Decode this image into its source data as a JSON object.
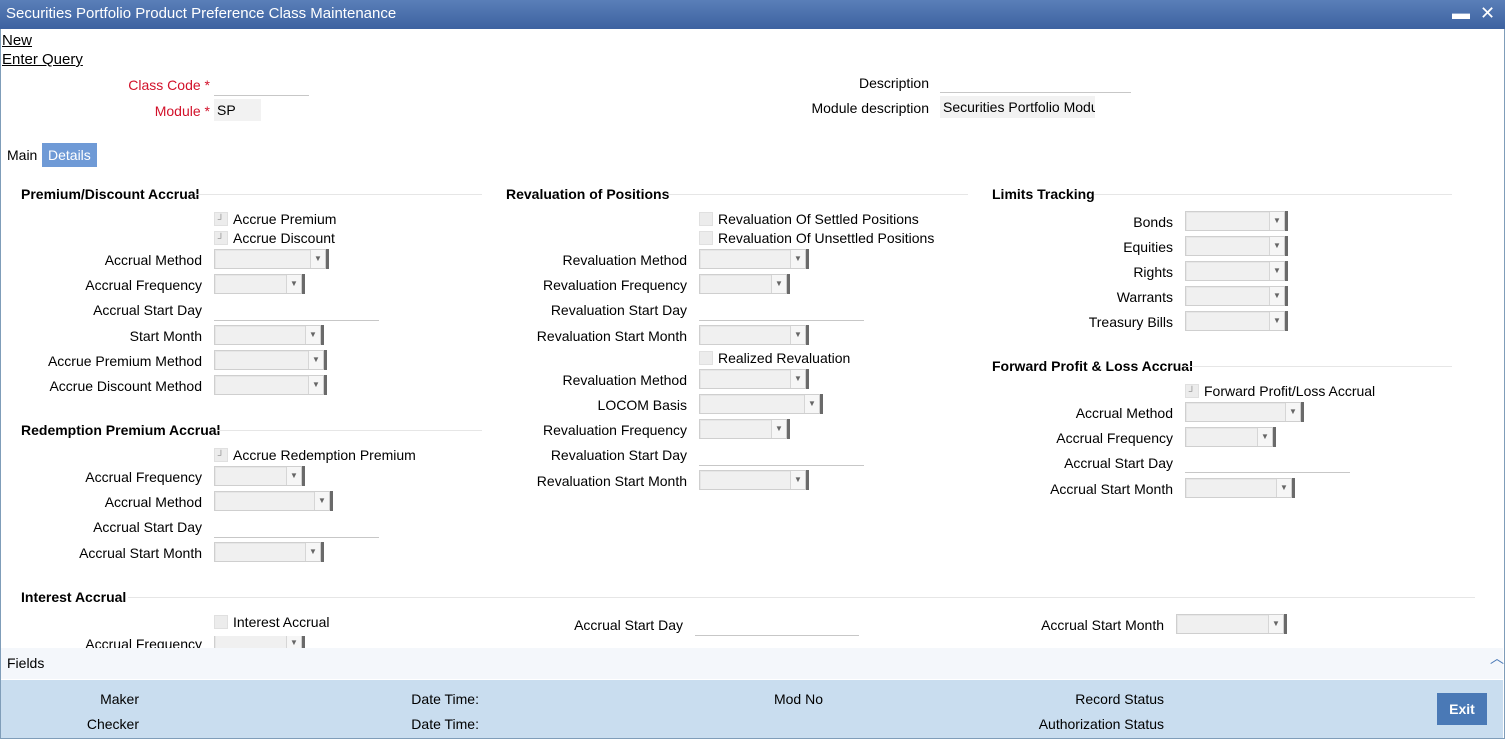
{
  "window": {
    "title": "Securities Portfolio Product Preference Class Maintenance",
    "minimize": "▬",
    "close": "✕"
  },
  "actions": {
    "new": "New",
    "enter_query": "Enter Query"
  },
  "header": {
    "class_code_label": "Class Code",
    "class_code_value": "",
    "module_label": "Module",
    "module_value": "SP",
    "required_mark": "*",
    "description_label": "Description",
    "description_value": "",
    "module_description_label": "Module description",
    "module_description_value": "Securities Portfolio Modul"
  },
  "tabs": [
    "Main",
    "Details"
  ],
  "active_tab": "Details",
  "premium_discount": {
    "title": "Premium/Discount Accrual",
    "accrue_premium": "Accrue Premium",
    "accrue_discount": "Accrue Discount",
    "accrual_method": "Accrual Method",
    "accrual_frequency": "Accrual Frequency",
    "accrual_start_day": "Accrual Start Day",
    "start_month": "Start Month",
    "accrue_premium_method": "Accrue Premium Method",
    "accrue_discount_method": "Accrue Discount Method"
  },
  "redemption": {
    "title": "Redemption Premium Accrual",
    "accrue_redemption_premium": "Accrue Redemption Premium",
    "accrual_frequency": "Accrual Frequency",
    "accrual_method": "Accrual Method",
    "accrual_start_day": "Accrual Start Day",
    "accrual_start_month": "Accrual Start Month"
  },
  "revaluation": {
    "title": "Revaluation of Positions",
    "settled": "Revaluation Of Settled Positions",
    "unsettled": "Revaluation Of Unsettled Positions",
    "method_1": "Revaluation Method",
    "frequency_1": "Revaluation Frequency",
    "start_day_1": "Revaluation Start Day",
    "start_month_1": "Revaluation Start Month",
    "realized": "Realized Revaluation",
    "method_2": "Revaluation Method",
    "locom_basis": "LOCOM Basis",
    "frequency_2": "Revaluation Frequency",
    "start_day_2": "Revaluation Start Day",
    "start_month_2": "Revaluation Start Month"
  },
  "limits": {
    "title": "Limits Tracking",
    "bonds": "Bonds",
    "equities": "Equities",
    "rights": "Rights",
    "warrants": "Warrants",
    "treasury_bills": "Treasury Bills"
  },
  "forward_pl": {
    "title": "Forward Profit & Loss Accrual",
    "checkbox": "Forward Profit/Loss Accrual",
    "accrual_method": "Accrual Method",
    "accrual_frequency": "Accrual Frequency",
    "accrual_start_day": "Accrual Start Day",
    "accrual_start_month": "Accrual Start Month"
  },
  "interest": {
    "title": "Interest Accrual",
    "checkbox": "Interest Accrual",
    "accrual_frequency": "Accrual Frequency",
    "accrual_start_day": "Accrual Start Day",
    "accrual_start_month": "Accrual Start Month"
  },
  "footer": {
    "fields": "Fields",
    "scroll_up": "︿",
    "maker": "Maker",
    "checker": "Checker",
    "date_time": "Date Time:",
    "mod_no": "Mod No",
    "record_status": "Record Status",
    "authorization_status": "Authorization Status",
    "exit": "Exit"
  },
  "colors": {
    "title_bar": "#3d62a0",
    "active_tab": "#6f9ad6",
    "required": "#d2112a",
    "audit_bar": "#c9ddef",
    "exit_button": "#4a79b6"
  }
}
